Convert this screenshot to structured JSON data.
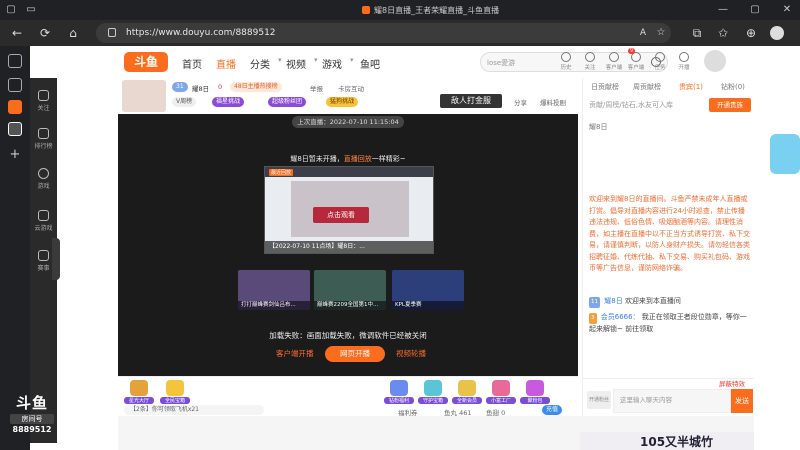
{
  "browser": {
    "tab_title": "耀8日直播_王者荣耀直播_斗鱼直播",
    "url": "https://www.douyu.com/8889512"
  },
  "douyu_sidebar": {
    "items": [
      {
        "label": "关注",
        "icon": "heart-icon"
      },
      {
        "label": "排行榜",
        "icon": "ranking-icon"
      },
      {
        "label": "游戏",
        "icon": "mouse-icon"
      },
      {
        "label": "云游戏",
        "icon": "gamepad-icon"
      },
      {
        "label": "赛事",
        "icon": "trophy-icon"
      }
    ]
  },
  "watermark": {
    "logo": "斗鱼",
    "sub": "房间号",
    "room": "8889512"
  },
  "header": {
    "logo": "斗鱼",
    "menu": [
      {
        "label": "首页",
        "active": false
      },
      {
        "label": "直播",
        "active": true
      },
      {
        "label": "分类",
        "dropdown": true
      },
      {
        "label": "视频",
        "dropdown": true
      },
      {
        "label": "游戏",
        "dropdown": true
      },
      {
        "label": "鱼吧",
        "dropdown": false
      }
    ],
    "search_placeholder": "lose愛游",
    "icons": [
      {
        "label": "历史",
        "icon": "history-icon"
      },
      {
        "label": "关注",
        "icon": "follow-icon"
      },
      {
        "label": "客户端",
        "icon": "download-icon"
      },
      {
        "label": "客户端",
        "icon": "client-icon"
      },
      {
        "label": "任务",
        "icon": "task-icon"
      },
      {
        "label": "开播",
        "icon": "broadcast-icon"
      }
    ],
    "badge": "9"
  },
  "anchor": {
    "name": "耀8日",
    "level": "31",
    "hot": "0",
    "fans_label": "V周榜",
    "tag1": "福星挑战",
    "tag1_level": "1",
    "tag2": "超级粉丝团",
    "tag3": "猛狗挑战",
    "hot_label": "48日主播热搜榜",
    "report": "举报",
    "card_label": "卡房互动",
    "fight_label": "敌人打金服",
    "share_label": "分享",
    "clip_label": "爆料投剧"
  },
  "player": {
    "last_live": "上次直播：2022-07-10 11:15:04",
    "title_prefix": "耀8日暂未开播，",
    "title_link": "直播回放",
    "title_suffix": "一样精彩~",
    "replay_tag": "最近回放",
    "replay_button": "点击观看",
    "replay_caption": "【2022-07-10 11点场】耀8日：...",
    "thumbs": [
      {
        "caption": "打打巅峰赛剑仙吕布..."
      },
      {
        "caption": "巅峰赛2209全国第1中..."
      },
      {
        "caption": "KPL夏季赛"
      }
    ],
    "load_fail": "加载失败：画面加载失败，微调软件已经被关闭",
    "client_button": "客户端开播",
    "web_button": "网页开播",
    "video_button": "视频轮播"
  },
  "gifts": {
    "left": [
      "星光大厅",
      "全民宝箱"
    ],
    "right": [
      "钻粉福利",
      "守护宝箱",
      "全新会员",
      "小富工厂",
      "聚粉包"
    ],
    "chat_hint": "【2条】你可领取飞机x21"
  },
  "right_panel": {
    "tabs": [
      "日贡献榜",
      "周贡献榜",
      "贵宾(1)",
      "钻粉(0)"
    ],
    "rank_row": "贡献/周榜/钻石,水友可入库",
    "guard_button": "开通贵族",
    "room_name": "耀8日",
    "notice": "欢迎来到耀8日的直播间。斗鱼严禁未成年人直播或打赏。倡导对直播内容进行24小时巡查，禁止传播违法违规、低俗色情、吸烟酗酒等内容。请理性消费，如主播在直播中以不正当方式诱导打赏、私下交易，请谨慎判断，以防人身财产损失。请勿轻信各类招聘征婚、代练代抽、私下交易、购买礼包码、游戏币等广告信息，谨防网络诈骗。",
    "messages": [
      {
        "level": "11",
        "name": "耀8日",
        "text": "欢迎来到本直播间"
      },
      {
        "level": "3",
        "name": "会员6666：",
        "text": "我正在领取王者段位勋章，等你一起来解锁~ 前往领取"
      }
    ],
    "chat_placeholder": "这里输入聊天内容",
    "fans_label": "开通粉丝",
    "send_label": "发送",
    "block_label": "屏蔽特效"
  },
  "bottom_ad": "105又半城竹",
  "bottom_stats": {
    "fishball": "鱼丸 461",
    "fishtooth": "鱼翅 0",
    "recharge": "充值",
    "prefix": "福利券"
  },
  "colors": {
    "accent": "#fb6d1c",
    "dark": "#1b1b1b"
  }
}
